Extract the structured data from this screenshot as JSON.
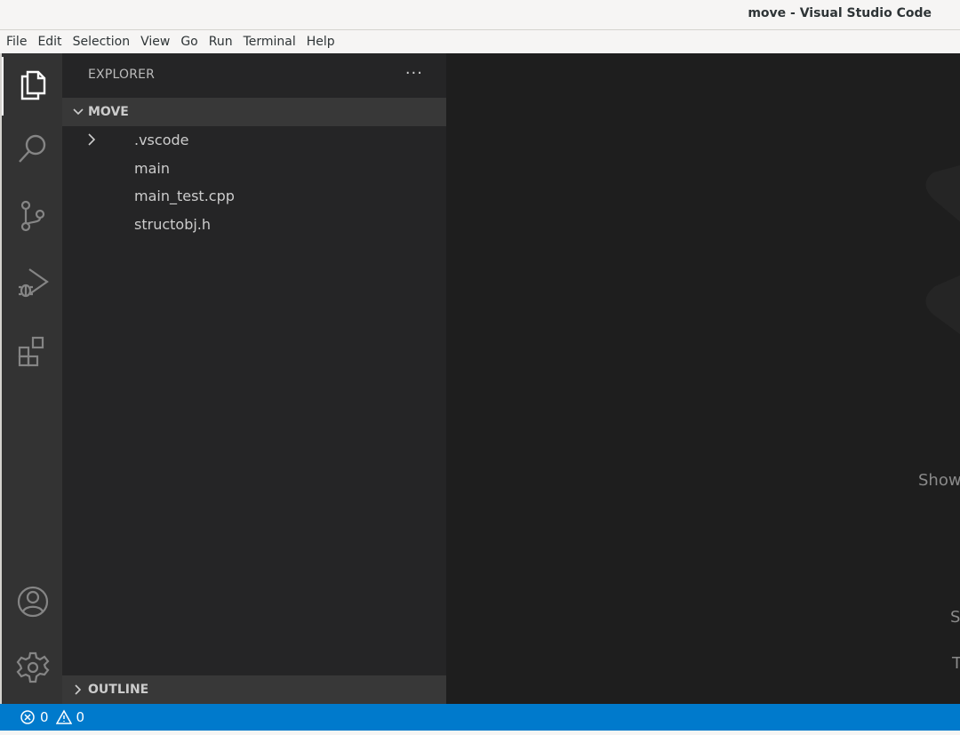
{
  "window": {
    "title": "move - Visual Studio Code"
  },
  "menu": [
    "File",
    "Edit",
    "Selection",
    "View",
    "Go",
    "Run",
    "Terminal",
    "Help"
  ],
  "activity": [
    {
      "icon": "files-icon",
      "active": true
    },
    {
      "icon": "search-icon",
      "active": false
    },
    {
      "icon": "source-control-icon",
      "active": false
    },
    {
      "icon": "run-debug-icon",
      "active": false
    },
    {
      "icon": "extensions-icon",
      "active": false
    },
    {
      "icon": "accounts-icon",
      "active": false
    },
    {
      "icon": "gear-icon",
      "active": false
    }
  ],
  "sidebar": {
    "title": "EXPLORER",
    "more_label": "···",
    "folder": {
      "name": "MOVE",
      "items": [
        {
          "label": ".vscode",
          "type": "folder"
        },
        {
          "label": "main",
          "type": "file"
        },
        {
          "label": "main_test.cpp",
          "type": "file"
        },
        {
          "label": "structobj.h",
          "type": "file"
        }
      ]
    },
    "outline": {
      "name": "OUTLINE"
    }
  },
  "editor": {
    "hints": [
      "Show",
      "S",
      "T"
    ]
  },
  "status": {
    "errors": "0",
    "warnings": "0",
    "color": "#007acc"
  }
}
